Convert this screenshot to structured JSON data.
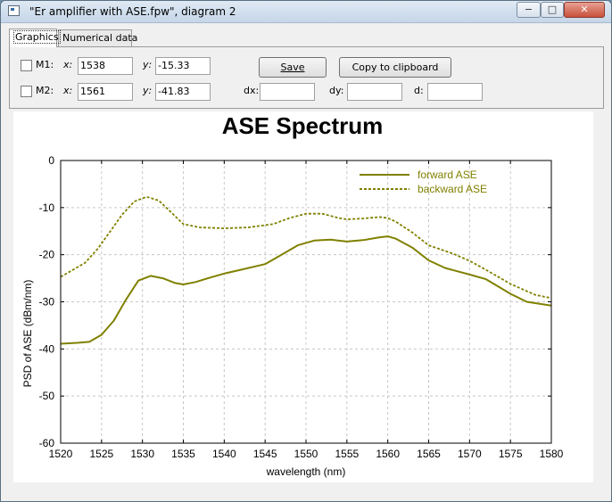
{
  "window": {
    "title": "\"Er amplifier with ASE.fpw\", diagram 2",
    "minimize_glyph": "−",
    "maximize_glyph": "□",
    "close_glyph": "✕"
  },
  "tabs": [
    {
      "label": "Graphics",
      "active": true
    },
    {
      "label": "Numerical data",
      "active": false
    }
  ],
  "markers": {
    "m1": {
      "label": "M1:",
      "x_label": "x:",
      "x": "1538",
      "y_label": "y:",
      "y": "-15.33"
    },
    "m2": {
      "label": "M2:",
      "x_label": "x:",
      "x": "1561",
      "y_label": "y:",
      "y": "-41.83"
    },
    "dx_label": "dx:",
    "dx": "",
    "dy_label": "dy:",
    "dy": "",
    "d_label": "d:",
    "d": ""
  },
  "buttons": {
    "save": "Save",
    "copy": "Copy to clipboard"
  },
  "chart_data": {
    "type": "line",
    "title": "ASE Spectrum",
    "xlabel": "wavelength (nm)",
    "ylabel": "PSD of ASE (dBm/nm)",
    "xlim": [
      1520,
      1580
    ],
    "ylim": [
      -60,
      0
    ],
    "xticks": [
      1520,
      1525,
      1530,
      1535,
      1540,
      1545,
      1550,
      1555,
      1560,
      1565,
      1570,
      1575,
      1580
    ],
    "yticks": [
      0,
      -10,
      -20,
      -30,
      -40,
      -50,
      -60
    ],
    "grid": true,
    "legend_position": "top-right",
    "color": "#808000",
    "series": [
      {
        "name": "forward ASE",
        "style": "solid",
        "x": [
          1520,
          1522,
          1523.5,
          1525,
          1526.5,
          1528,
          1529.5,
          1531,
          1532.5,
          1534,
          1535,
          1536.5,
          1538,
          1540,
          1542,
          1545,
          1547,
          1549,
          1551,
          1553,
          1555,
          1557,
          1559,
          1560,
          1561,
          1563,
          1565,
          1567,
          1570,
          1572,
          1575,
          1577,
          1580
        ],
        "y": [
          -38.9,
          -38.7,
          -38.5,
          -37,
          -34,
          -29.5,
          -25.5,
          -24.5,
          -25,
          -26,
          -26.3,
          -25.8,
          -25,
          -24,
          -23.2,
          -22,
          -20,
          -18,
          -17,
          -16.8,
          -17.2,
          -16.9,
          -16.3,
          -16.1,
          -16.6,
          -18.5,
          -21.2,
          -22.8,
          -24.2,
          -25.2,
          -28.3,
          -30,
          -30.8
        ]
      },
      {
        "name": "backward ASE",
        "style": "dotted",
        "x": [
          1520,
          1521.5,
          1523,
          1524.5,
          1526,
          1527.5,
          1529,
          1530.5,
          1532,
          1533.5,
          1535,
          1537,
          1540,
          1543,
          1546,
          1548,
          1550,
          1552,
          1554,
          1555,
          1557,
          1559,
          1560,
          1561,
          1563,
          1565,
          1568,
          1570,
          1572,
          1575,
          1578,
          1580
        ],
        "y": [
          -24.7,
          -23.2,
          -21.7,
          -18.8,
          -15.2,
          -11.5,
          -8.7,
          -7.7,
          -8.5,
          -11,
          -13.5,
          -14.2,
          -14.4,
          -14.2,
          -13.5,
          -12.2,
          -11.3,
          -11.3,
          -12.2,
          -12.5,
          -12.3,
          -12,
          -12.2,
          -13,
          -15.3,
          -18,
          -19.8,
          -21.3,
          -23.2,
          -26.2,
          -28.5,
          -29.2
        ]
      }
    ]
  }
}
